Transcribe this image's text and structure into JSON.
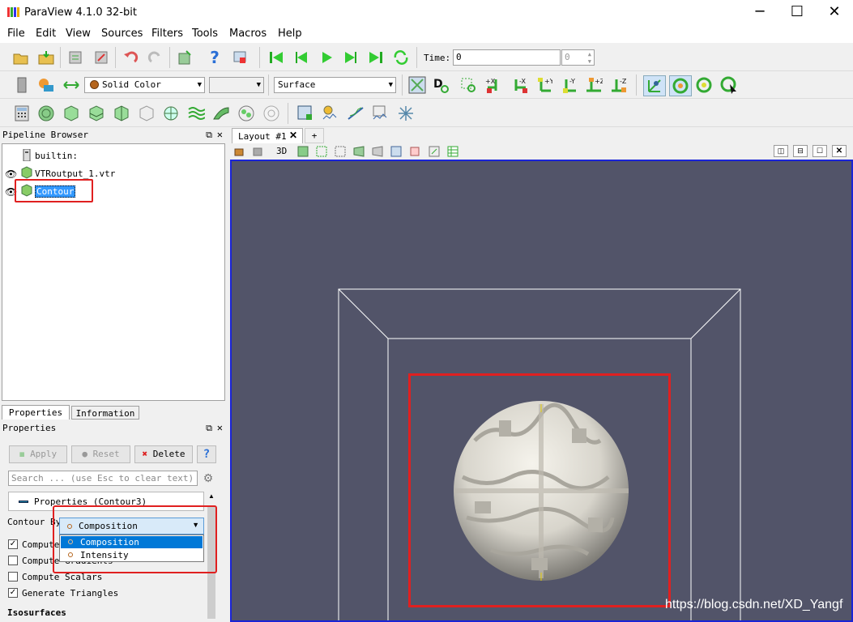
{
  "window": {
    "title": "ParaView 4.1.0 32-bit",
    "minimize": "─",
    "maximize": "☐",
    "close": "✕"
  },
  "menu": [
    "File",
    "Edit",
    "View",
    "Sources",
    "Filters",
    "Tools",
    "Macros",
    "Help"
  ],
  "time": {
    "label": "Time:",
    "value": "0",
    "step": "0"
  },
  "color_combo": "Solid Color",
  "repr_combo": "Surface",
  "axis_buttons": [
    "+X",
    "-X",
    "+Y",
    "-Y",
    "+Z",
    "-Z"
  ],
  "pipeline": {
    "title": "Pipeline Browser",
    "items": [
      {
        "label": "builtin:"
      },
      {
        "label": "VTRoutput_1.vtr"
      },
      {
        "label": "Contour"
      }
    ]
  },
  "tabs": {
    "properties": "Properties",
    "information": "Information"
  },
  "properties": {
    "title": "Properties",
    "apply": "Apply",
    "reset": "Reset",
    "delete": "Delete",
    "help": "?",
    "search_placeholder": "Search ... (use Esc to clear text)",
    "section": "Properties (Contour3)",
    "contour_by_label": "Contour By",
    "contour_by_value": "Composition",
    "contour_by_options": [
      "Composition",
      "Intensity"
    ],
    "checkboxes": [
      {
        "label": "Compute Normals",
        "checked": true
      },
      {
        "label": "Compute Gradients",
        "checked": false
      },
      {
        "label": "Compute Scalars",
        "checked": false
      },
      {
        "label": "Generate Triangles",
        "checked": true
      }
    ],
    "isosurfaces": "Isosurfaces"
  },
  "layout": {
    "tab": "Layout #1",
    "add": "+",
    "mode3d": "3D"
  },
  "watermark": "https://blog.csdn.net/XD_Yangf",
  "colors": {
    "viewport": "#525469",
    "highlight": "#3399ff",
    "annotation": "#e02020"
  }
}
